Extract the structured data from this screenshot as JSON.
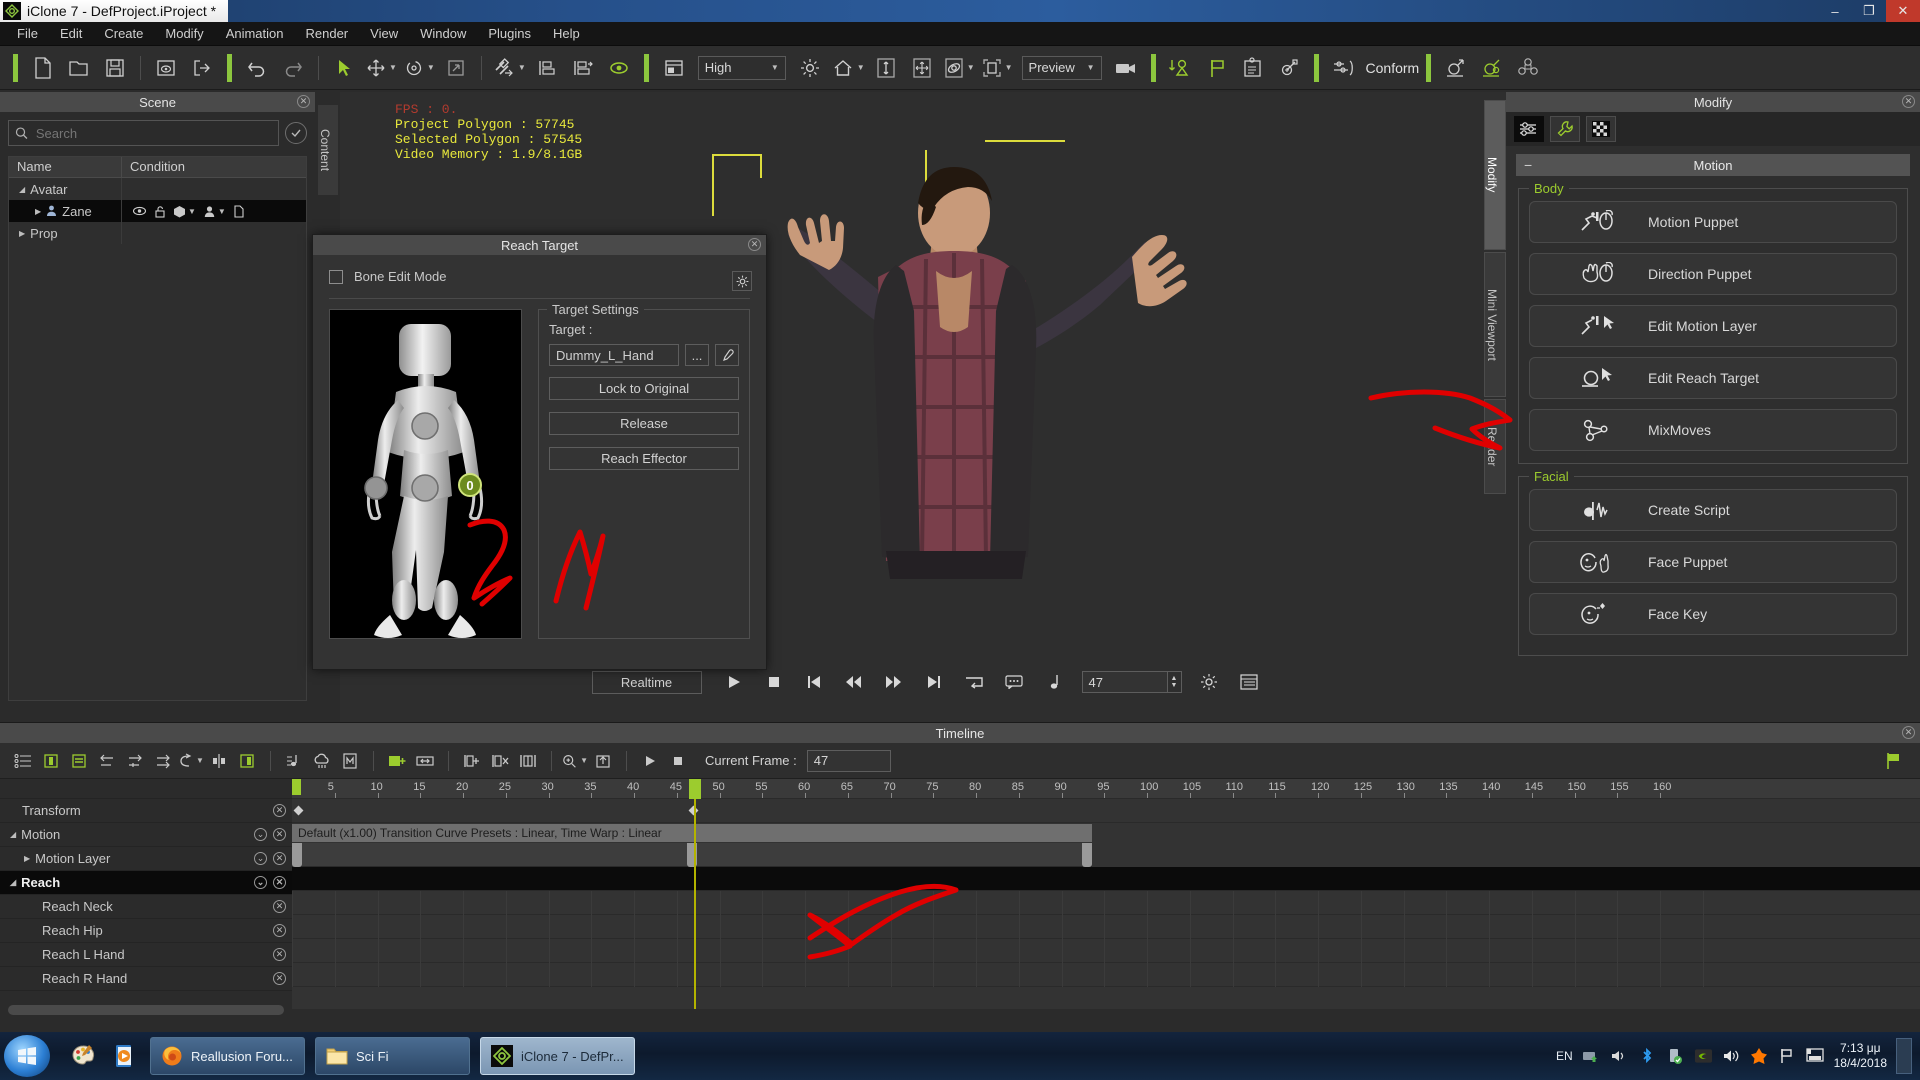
{
  "window": {
    "title": "iClone 7 - DefProject.iProject *",
    "app_icon": "iclone-logo-icon",
    "minimize": "–",
    "maximize": "❐",
    "close": "✕"
  },
  "menubar": {
    "items": [
      "File",
      "Edit",
      "Create",
      "Modify",
      "Animation",
      "Render",
      "View",
      "Window",
      "Plugins",
      "Help"
    ]
  },
  "toolbar": {
    "quality": "High",
    "render_mode": "Preview",
    "conform_label": "Conform",
    "icons": [
      "new-file-icon",
      "open-folder-icon",
      "save-icon",
      "preview-window-icon",
      "export-icon",
      "undo-icon",
      "redo-icon",
      "select-arrow-icon",
      "move-icon",
      "rotate-icon",
      "scale-icon",
      "link-icon",
      "align-icon",
      "align-to-icon",
      "eye-icon",
      "layout-icon",
      "light-icon",
      "home-icon",
      "height-icon",
      "move-xyz-icon",
      "orbit-icon",
      "frame-selected-icon",
      "camera-icon",
      "drop-to-floor-icon",
      "flag-icon",
      "task-list-icon",
      "add-node-icon",
      "conform-icon",
      "ground-object-icon",
      "attach-icon",
      "blocks-icon"
    ]
  },
  "scene": {
    "panel_title": "Scene",
    "search_placeholder": "Search",
    "columns": [
      "Name",
      "Condition"
    ],
    "rows": [
      {
        "name": "Avatar",
        "level": 0,
        "expanded": true,
        "icons": []
      },
      {
        "name": "Zane",
        "level": 1,
        "expanded": false,
        "selected": true,
        "icons": [
          "eye-icon",
          "lock-icon",
          "cube-icon",
          "person-icon",
          "page-icon"
        ]
      },
      {
        "name": "Prop",
        "level": 0,
        "expanded": false,
        "icons": []
      }
    ]
  },
  "content_tab": {
    "label": "Content"
  },
  "viewport": {
    "stats": {
      "fps": "FPS : 0.",
      "project_polygon": "Project Polygon : 57745",
      "selected_polygon": "Selected Polygon : 57545",
      "video_memory": "Video Memory : 1.9/8.1GB"
    },
    "note_icon": "comment-icon"
  },
  "reach_dialog": {
    "title": "Reach Target",
    "bone_edit_mode": "Bone Edit Mode",
    "gear_icon": "gear-icon",
    "target_settings_legend": "Target Settings",
    "target_label": "Target :",
    "target_value": "Dummy_L_Hand",
    "browse_label": "...",
    "picker_icon": "eyedropper-icon",
    "buttons": [
      "Lock to Original",
      "Release",
      "Reach Effector"
    ],
    "effector_badge": "0"
  },
  "right_tabs": [
    {
      "label": "Modify",
      "active": true
    },
    {
      "label": "Mini Viewport",
      "active": false
    },
    {
      "label": "Render",
      "active": false
    }
  ],
  "modify": {
    "panel_title": "Modify",
    "tools": [
      "sliders-icon",
      "wrench-icon",
      "checker-icon"
    ],
    "section": "Motion",
    "groups": [
      {
        "legend": "Body",
        "buttons": [
          {
            "label": "Motion Puppet",
            "icon": "run-mouse-icon"
          },
          {
            "label": "Direction Puppet",
            "icon": "hand-mouse-icon"
          },
          {
            "label": "Edit Motion Layer",
            "icon": "run-cursor-icon"
          },
          {
            "label": "Edit Reach Target",
            "icon": "circle-cursor-icon"
          },
          {
            "label": "MixMoves",
            "icon": "triangle-nodes-icon"
          }
        ]
      },
      {
        "legend": "Facial",
        "buttons": [
          {
            "label": "Create Script",
            "icon": "waveform-icon"
          },
          {
            "label": "Face Puppet",
            "icon": "face-hand-icon"
          },
          {
            "label": "Face Key",
            "icon": "face-key-icon"
          }
        ]
      }
    ]
  },
  "playback": {
    "mode": "Realtime",
    "frame_value": "47",
    "buttons": [
      "play-icon",
      "stop-icon",
      "jump-start-icon",
      "prev-frame-icon",
      "next-frame-icon",
      "jump-end-icon",
      "loop-icon",
      "speech-icon",
      "note-icon"
    ],
    "trailing_icons": [
      "settings-icon",
      "list-icon"
    ]
  },
  "timeline": {
    "title": "Timeline",
    "current_frame_label": "Current Frame :",
    "current_frame_value": "47",
    "tools": [
      "track-list-icon",
      "collapse-tracks-icon",
      "expand-tracks-icon",
      "prev-key-icon",
      "add-key-icon",
      "next-key-icon",
      "loop-range-icon",
      "split-icon",
      "range-icon",
      "audio-icon",
      "cloud-icon",
      "motion-icon",
      "add-clip-icon",
      "stretch-icon",
      "insert-frame-icon",
      "delete-frame-icon",
      "frame-range-icon",
      "zoom-icon",
      "export-clip-icon"
    ],
    "play_icon": "play-icon",
    "stop_icon": "stop-icon",
    "flag_icon": "flag-icon",
    "ruler_ticks": [
      5,
      10,
      15,
      20,
      25,
      30,
      35,
      40,
      45,
      50,
      55,
      60,
      65,
      70,
      75,
      80,
      85,
      90,
      95,
      100,
      105,
      110,
      115,
      120,
      125,
      130,
      135,
      140,
      145,
      150,
      155,
      160
    ],
    "clip_label": "Default (x1.00) Transition Curve Presets : Linear, Time Warp : Linear",
    "tracks": [
      {
        "label": "Transform",
        "level": 1,
        "icons": [
          "close-circle-icon"
        ]
      },
      {
        "label": "Motion",
        "level": 0,
        "expanded": true,
        "icons": [
          "chevron-circle-icon",
          "close-circle-icon"
        ]
      },
      {
        "label": "Motion Layer",
        "level": 1,
        "expanded": false,
        "icons": [
          "chevron-circle-icon",
          "close-circle-icon"
        ]
      },
      {
        "label": "Reach",
        "level": 0,
        "expanded": true,
        "selected": true,
        "icons": [
          "chevron-circle-icon",
          "close-circle-icon"
        ]
      },
      {
        "label": "Reach Neck",
        "level": 2,
        "icons": [
          "close-circle-icon"
        ]
      },
      {
        "label": "Reach Hip",
        "level": 2,
        "icons": [
          "close-circle-icon"
        ]
      },
      {
        "label": "Reach L Hand",
        "level": 2,
        "icons": [
          "close-circle-icon"
        ]
      },
      {
        "label": "Reach R Hand",
        "level": 2,
        "icons": [
          "close-circle-icon"
        ]
      }
    ],
    "playhead_frame": 47
  },
  "taskbar": {
    "start_icon": "windows-start-icon",
    "quicklaunch": [
      "paint-icon",
      "media-player-icon"
    ],
    "tasks": [
      {
        "label": "Reallusion Foru...",
        "icon": "firefox-icon",
        "active": false
      },
      {
        "label": "Sci Fi",
        "icon": "folder-icon",
        "active": false
      },
      {
        "label": "iClone 7 - DefPr...",
        "icon": "iclone-logo-icon",
        "active": true
      }
    ],
    "tray": {
      "language": "EN",
      "icons": [
        "network-icon",
        "speaker-tray-icon",
        "bluetooth-icon",
        "usb-icon",
        "nvidia-icon",
        "volume-icon",
        "avast-icon",
        "flag-tray-icon",
        "monitor-icon"
      ],
      "time": "7:13 μμ",
      "date": "18/4/2018"
    }
  },
  "colors": {
    "accent_green": "#9ccc2e",
    "annotation_red": "#e00000",
    "yellow_stat": "#e8e83c",
    "red_stat": "#b33b2e",
    "orange_gizmo": "#ef8d12"
  }
}
